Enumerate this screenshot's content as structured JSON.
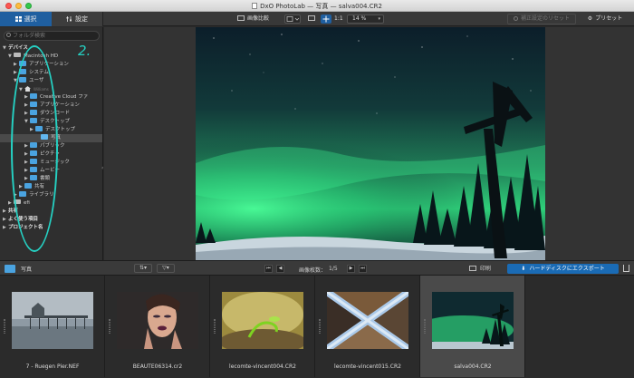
{
  "window": {
    "title": "DxO PhotoLab — 写真 — salva004.CR2"
  },
  "toolbar": {
    "tab_select": "選択",
    "tab_settings": "設定",
    "compare_label": "画像比較",
    "one_to_one": "1:1",
    "zoom_value": "14 %",
    "reset_label": "補正設定のリセット",
    "preset_label": "プリセット"
  },
  "sidebar": {
    "search_placeholder": "フォルダ検索",
    "annotation_number": "2.",
    "tree": [
      {
        "label": "デバイス",
        "level": 0,
        "kind": "section",
        "expanded": true
      },
      {
        "label": "Macintosh HD",
        "level": 1,
        "kind": "drive",
        "expanded": true
      },
      {
        "label": "アプリケーション",
        "level": 2,
        "kind": "folder",
        "expanded": false
      },
      {
        "label": "システム",
        "level": 2,
        "kind": "folder",
        "expanded": false
      },
      {
        "label": "ユーザ",
        "level": 2,
        "kind": "folder",
        "expanded": true
      },
      {
        "label": "Williams",
        "level": 3,
        "kind": "home",
        "expanded": true
      },
      {
        "label": "Creative Cloud ファ",
        "level": 4,
        "kind": "folder",
        "expanded": false
      },
      {
        "label": "アプリケーション",
        "level": 4,
        "kind": "folder",
        "expanded": false
      },
      {
        "label": "ダウンロード",
        "level": 4,
        "kind": "folder",
        "expanded": false
      },
      {
        "label": "デスクトップ",
        "level": 4,
        "kind": "folder",
        "expanded": true
      },
      {
        "label": "デスクトップ",
        "level": 5,
        "kind": "folder",
        "expanded": false
      },
      {
        "label": "写真",
        "level": 6,
        "kind": "folder-open",
        "expanded": false,
        "selected": true
      },
      {
        "label": "パブリック",
        "level": 4,
        "kind": "folder",
        "expanded": false
      },
      {
        "label": "ピクチャ",
        "level": 4,
        "kind": "folder",
        "expanded": false
      },
      {
        "label": "ミュージック",
        "level": 4,
        "kind": "folder",
        "expanded": false
      },
      {
        "label": "ムービー",
        "level": 4,
        "kind": "folder",
        "expanded": false
      },
      {
        "label": "書類",
        "level": 4,
        "kind": "folder",
        "expanded": false
      },
      {
        "label": "共有",
        "level": 3,
        "kind": "folder",
        "expanded": false
      },
      {
        "label": "ライブラリ",
        "level": 2,
        "kind": "folder",
        "expanded": false
      },
      {
        "label": "efi",
        "level": 1,
        "kind": "drive",
        "expanded": false
      },
      {
        "label": "共有",
        "level": 0,
        "kind": "section",
        "expanded": false
      },
      {
        "label": "よく使う項目",
        "level": 0,
        "kind": "section",
        "expanded": false
      },
      {
        "label": "プロジェクト名",
        "level": 0,
        "kind": "section",
        "expanded": false
      }
    ]
  },
  "filmstrip_header": {
    "folder_name": "写真",
    "image_count_label": "画像枚数：",
    "image_count_value": "1/5",
    "print_label": "印刷",
    "export_label": "ハードディスクにエクスポート"
  },
  "filmstrip": {
    "items": [
      {
        "name": "7 - Ruegen Pier.NEF",
        "selected": false
      },
      {
        "name": "BEAUTE06314.cr2",
        "selected": false
      },
      {
        "name": "lecomte-vincent004.CR2",
        "selected": false
      },
      {
        "name": "lecomte-vincent015.CR2",
        "selected": false
      },
      {
        "name": "salva004.CR2",
        "selected": true
      }
    ]
  },
  "colors": {
    "accent": "#1a6bb5",
    "annotation": "#25d0c2",
    "folder": "#4aa3e0"
  }
}
